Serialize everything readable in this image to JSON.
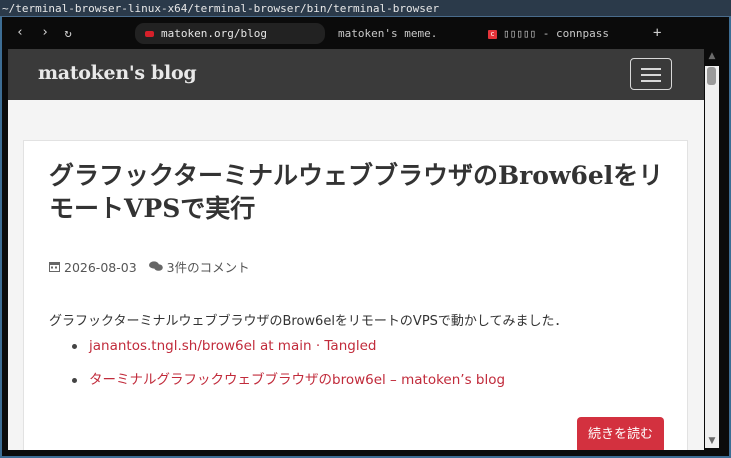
{
  "window": {
    "title": "~/terminal-browser-linux-x64/terminal-browser/bin/terminal-browser"
  },
  "browser": {
    "nav": {
      "back": "‹",
      "forward": "›",
      "reload": "↻"
    },
    "tabs": [
      {
        "label": "matoken.org/blog",
        "icon": "red-favicon-icon",
        "active": true
      },
      {
        "label": "matoken's meme.",
        "icon": "",
        "active": false
      },
      {
        "label": "▯▯▯▯▯ - connpass",
        "icon": "connpass-icon",
        "active": false
      }
    ],
    "new_tab": "+"
  },
  "page": {
    "brand": "matoken's blog",
    "post": {
      "title": "グラフックターミナルウェブブラウザのBrow6elをリモートVPSで実行",
      "date": "2026-08-03",
      "comments": "3件のコメント",
      "excerpt": "グラフックターミナルウェブブラウザのBrow6elをリモートのVPSで動かしてみました．",
      "links": [
        "janantos.tngl.sh/brow6el at main · Tangled",
        "ターミナルグラフックウェブブラウザのbrow6el – matoken’s blog"
      ],
      "read_more": "続きを読む"
    }
  },
  "colors": {
    "navbar": "#3a3a3a",
    "accent": "#d3313f",
    "link": "#c12b3b",
    "frame_border": "#3d6d94"
  }
}
